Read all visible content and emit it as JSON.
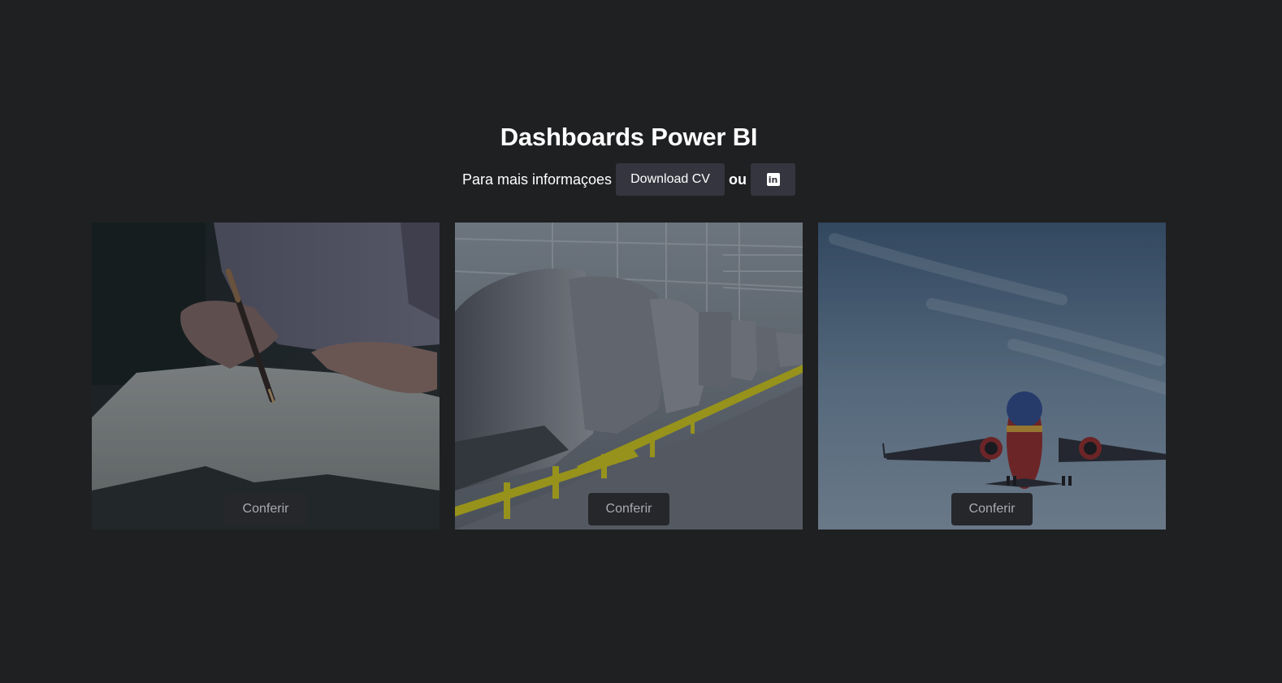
{
  "header": {
    "title": "Dashboards Power BI",
    "info_text": "Para mais informaçoes",
    "download_label": "Download CV",
    "or_text": "ou",
    "linkedin_glyph": "in",
    "linkedin_icon": "linkedin-icon"
  },
  "cards": [
    {
      "image": "hand-writing-with-pen-photo",
      "button_label": "Conferir"
    },
    {
      "image": "car-assembly-line-photo",
      "button_label": "Conferir"
    },
    {
      "image": "airplane-in-sky-photo",
      "button_label": "Conferir"
    }
  ],
  "colors": {
    "background": "#1f2022",
    "button": "#35353f",
    "card_button": "#26272b",
    "card_button_text": "#a9abb2"
  }
}
